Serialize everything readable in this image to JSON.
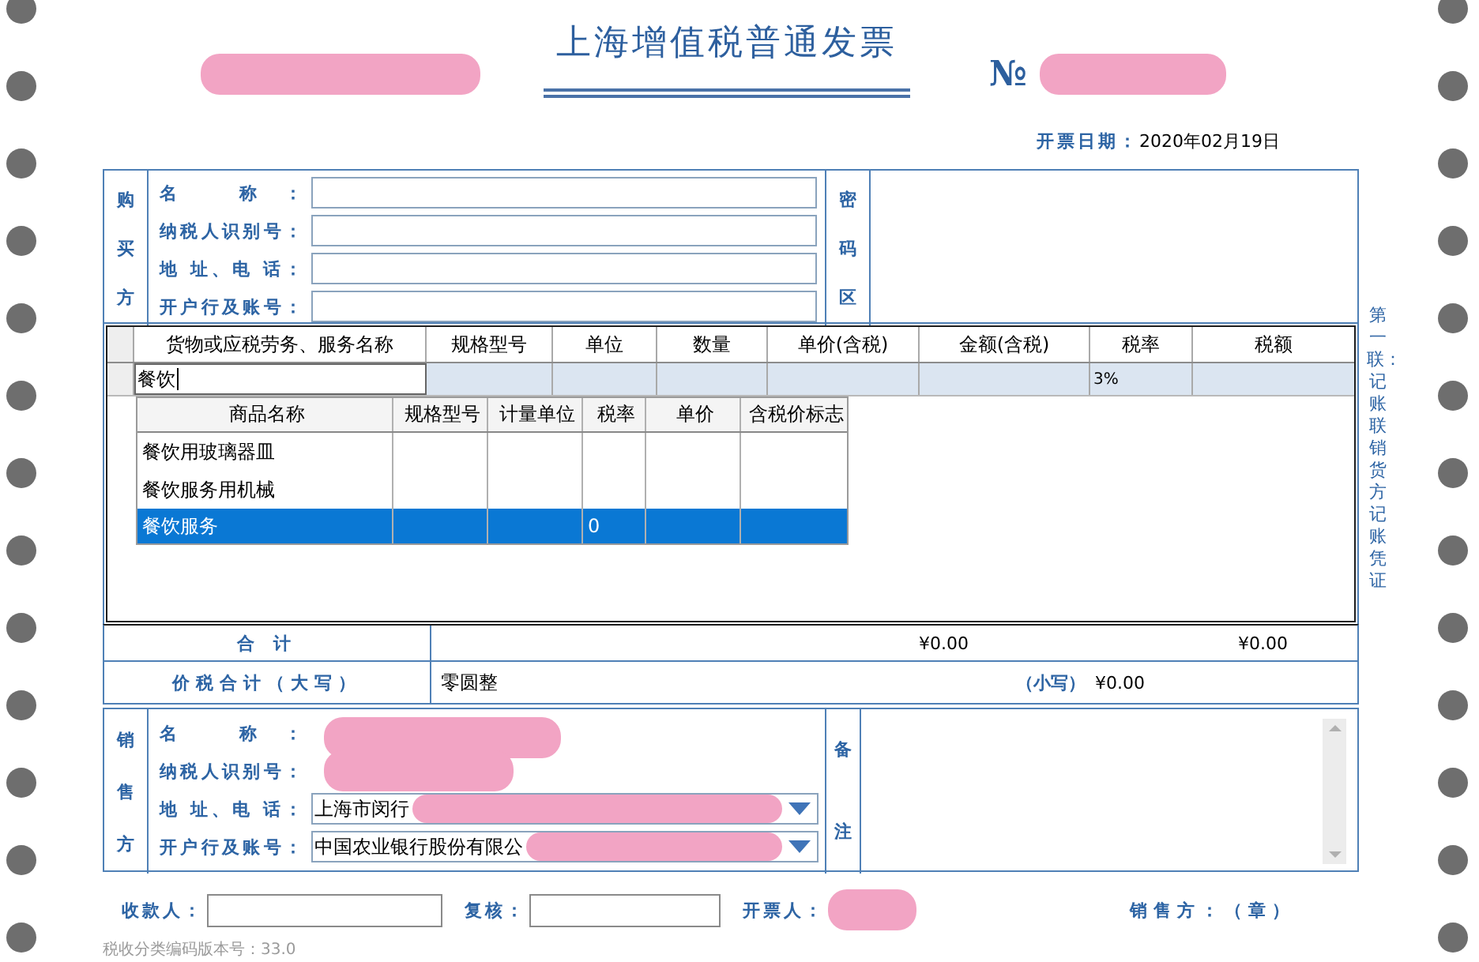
{
  "header": {
    "title": "上海增值税普通发票",
    "code_redacted": true,
    "number_label": "№",
    "number_redacted": true,
    "date_label": "开票日期：",
    "date": "2020年02月19日"
  },
  "buyer": {
    "section_label": "购买方",
    "fields": [
      {
        "label": "名 称："
      },
      {
        "label": "纳税人识别号："
      },
      {
        "label": "地 址、电 话："
      },
      {
        "label": "开户行及账号："
      }
    ],
    "cipher_label": "密码区"
  },
  "goods": {
    "columns": [
      "货物或应税劳务、服务名称",
      "规格型号",
      "单位",
      "数量",
      "单价(含税)",
      "金额(含税)",
      "税率",
      "税额"
    ],
    "rows": [
      {
        "name": "餐饮",
        "tax_rate": "3%"
      }
    ]
  },
  "suggestions": {
    "columns": [
      "商品名称",
      "规格型号",
      "计量单位",
      "税率",
      "单价",
      "含税价标志"
    ],
    "rows": [
      {
        "name": "餐饮用玻璃器皿",
        "selected": false
      },
      {
        "name": "餐饮服务用机械",
        "selected": false
      },
      {
        "name": "餐饮服务",
        "tax_rate": "0",
        "selected": true
      }
    ]
  },
  "totals": {
    "label": "合 计",
    "amount": "¥0.00",
    "tax": "¥0.00"
  },
  "grand_total": {
    "label": "价税合计（大写）",
    "words": "零圆整",
    "figures_label": "（小写）",
    "figures": "¥0.00"
  },
  "seller": {
    "section_label": "销售方",
    "fields": [
      {
        "label": "名 称：",
        "kind": "redacted"
      },
      {
        "label": "纳税人识别号：",
        "kind": "redacted"
      },
      {
        "label": "地 址、电 话：",
        "kind": "select",
        "value": "上海市闵行",
        "redacted": true
      },
      {
        "label": "开户行及账号：",
        "kind": "select",
        "value": "中国农业银行股份有限公",
        "redacted": true
      }
    ],
    "remarks_label": "备注"
  },
  "signatures": [
    {
      "label": "收款人：",
      "kind": "field"
    },
    {
      "label": "复核：",
      "kind": "field"
    },
    {
      "label": "开票人：",
      "kind": "redacted"
    }
  ],
  "seal": "销售方：（章）",
  "copy_note": "第一联：记账联销货方记账凭证",
  "version": "税收分类编码版本号：33.0"
}
